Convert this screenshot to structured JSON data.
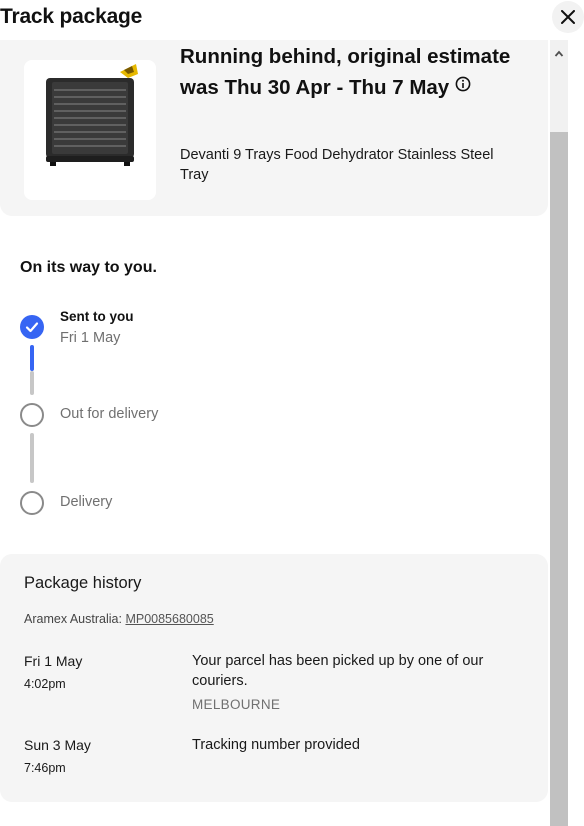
{
  "header": {
    "title": "Track package",
    "close_icon": "close-icon"
  },
  "item": {
    "status": "Running behind, original estimate was Thu 30 Apr - Thu 7 May",
    "info_icon": "info-icon",
    "title": "Devanti 9 Trays Food Dehydrator Stainless Steel Tray"
  },
  "progress": {
    "heading": "On its way to you.",
    "steps": [
      {
        "label": "Sent to you",
        "date": "Fri 1 May",
        "state": "done"
      },
      {
        "label": "Out for delivery",
        "date": "",
        "state": "pending"
      },
      {
        "label": "Delivery",
        "date": "",
        "state": "pending"
      }
    ]
  },
  "history": {
    "title": "Package history",
    "carrier": "Aramex Australia:",
    "tracking_number": "MP0085680085",
    "events": [
      {
        "date": "Fri 1 May",
        "time": "4:02pm",
        "description": "Your parcel has been picked up by one of our couriers.",
        "location": "MELBOURNE"
      },
      {
        "date": "Sun 3 May",
        "time": "7:46pm",
        "description": "Tracking number provided",
        "location": ""
      }
    ]
  },
  "colors": {
    "accent": "#3665f3",
    "card_bg": "#f5f5f5",
    "muted_text": "#707070",
    "rail_done": "#3665f3",
    "rail_pending": "#c7c7c7"
  }
}
